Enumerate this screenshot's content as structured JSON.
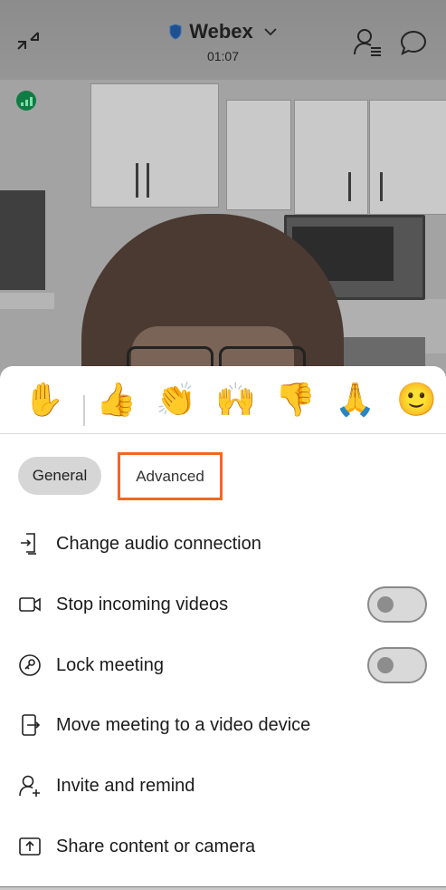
{
  "header": {
    "title": "Webex",
    "timer": "01:07"
  },
  "reactions": [
    {
      "name": "raise-hand",
      "glyph": "✋"
    },
    {
      "name": "thumbs-up",
      "glyph": "👍"
    },
    {
      "name": "clap",
      "glyph": "👏"
    },
    {
      "name": "celebrate",
      "glyph": "🙌"
    },
    {
      "name": "thumbs-down",
      "glyph": "👎"
    },
    {
      "name": "pray",
      "glyph": "🙏"
    },
    {
      "name": "smile",
      "glyph": "🙂"
    }
  ],
  "tabs": {
    "general": "General",
    "advanced": "Advanced",
    "selected": "General",
    "highlighted": "Advanced",
    "highlight_color": "#f26722"
  },
  "menu": [
    {
      "label": "Change audio connection",
      "icon": "audio-connection-icon"
    },
    {
      "label": "Stop incoming videos",
      "icon": "video-camera-icon",
      "toggle": "off"
    },
    {
      "label": "Lock meeting",
      "icon": "lock-meeting-icon",
      "toggle": "off"
    },
    {
      "label": "Move meeting to a video device",
      "icon": "move-device-icon"
    },
    {
      "label": "Invite and remind",
      "icon": "invite-person-icon"
    },
    {
      "label": "Share content or camera",
      "icon": "share-icon"
    }
  ],
  "colors": {
    "accent": "#f26722",
    "signal": "#0f7b45",
    "shield": "#1d4f91"
  }
}
